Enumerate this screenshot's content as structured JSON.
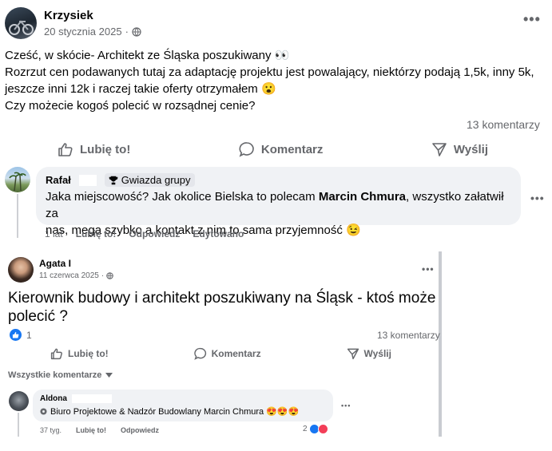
{
  "post": {
    "author": "Krzysiek",
    "date": "20 stycznia 2025",
    "meta_sep": "·",
    "text": [
      "Cześć, w skócie- Architekt ze Śląska poszukiwany 👀",
      "Rozrzut cen podawanych tutaj za adaptację projektu jest powalający, niektórzy podają 1,5k, inny 5k,",
      "jeszcze inni 12k i raczej takie oferty otrzymałem 😮",
      "Czy możecie kogoś polecić w rozsądnej cenie?"
    ],
    "comments_count": "13 komentarzy",
    "actions": {
      "like": "Lubię to!",
      "comment": "Komentarz",
      "share": "Wyślij"
    }
  },
  "comment": {
    "author": "Rafał",
    "badge": "Gwiazda grupy",
    "text_before": "Jaka miejscowość? Jak okolice Bielska to polecam ",
    "text_bold": "Marcin Chmura",
    "text_after_line1": ", wszystko załatwił za",
    "text_line2": "nas, mega szybko a kontakt z nim to sama przyjemność 😉",
    "time": "1 lat",
    "like": "Lubię to!",
    "reply": "Odpowiedz",
    "edited": "Edytowano"
  },
  "shared": {
    "author": "Agata I",
    "date": "11 czerwca 2025",
    "meta_sep": "·",
    "title_line1": "Kierownik budowy i architekt poszukiwany na Śląsk - ktoś może",
    "title_line2": "polecić ?",
    "reactions_count": "1",
    "comments_count": "13 komentarzy",
    "actions": {
      "like": "Lubię to!",
      "comment": "Komentarz",
      "share": "Wyślij"
    },
    "all_comments": "Wszystkie komentarze",
    "reply": {
      "author": "Aldona",
      "text": "Biuro Projektowe & Nadzór Budowlany Marcin Chmura 😍😍😍",
      "time": "37 tyg.",
      "like": "Lubię to!",
      "reply": "Odpowiedz",
      "reactions_count": "2"
    }
  },
  "colors": {
    "like_blue": "#1877f2",
    "love_red": "#f33e58",
    "text_muted": "#65676b",
    "bubble": "#f0f2f5"
  }
}
